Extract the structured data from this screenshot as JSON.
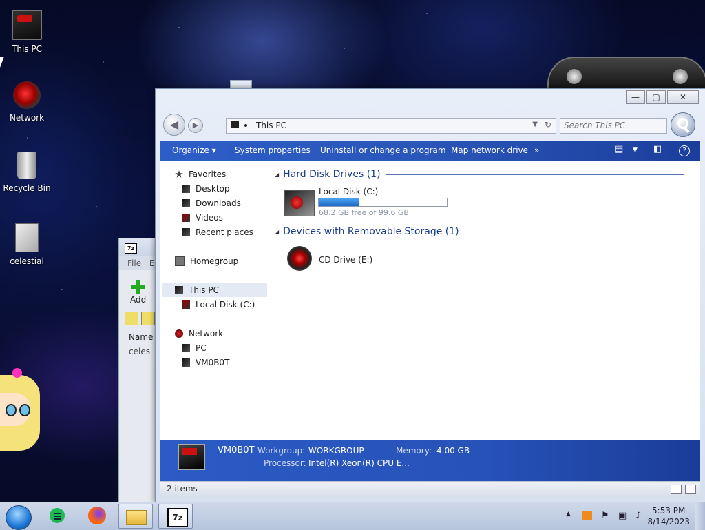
{
  "desktop": {
    "icons": [
      {
        "label": "This PC"
      },
      {
        "label": "Network"
      },
      {
        "label": "Recycle Bin"
      },
      {
        "label": "celestial"
      }
    ]
  },
  "zip_window": {
    "title_glyph": "7z",
    "menu": [
      "File",
      "E"
    ],
    "add_label": "Add",
    "column_name": "Name",
    "file_label": "celes"
  },
  "explorer": {
    "controls": {
      "minimize": "—",
      "maximize": "▢",
      "close": "✕"
    },
    "address": {
      "path": "This PC"
    },
    "search": {
      "placeholder": "Search This PC"
    },
    "commands": {
      "organize": "Organize ▾",
      "system_properties": "System properties",
      "uninstall": "Uninstall or change a program",
      "map_drive": "Map network drive",
      "more": "»"
    },
    "nav": {
      "favorites": "Favorites",
      "desktop": "Desktop",
      "downloads": "Downloads",
      "videos": "Videos",
      "recent": "Recent places",
      "homegroup": "Homegroup",
      "this_pc": "This PC",
      "local_disk": "Local Disk (C:)",
      "network": "Network",
      "pc": "PC",
      "vm": "VM0B0T"
    },
    "groups": {
      "hdd": "Hard Disk Drives (1)",
      "removable": "Devices with Removable Storage (1)"
    },
    "drives": {
      "c": {
        "name": "Local Disk (C:)",
        "free_text": "68.2 GB free of 99.6 GB",
        "used_fraction": 0.315
      },
      "e": {
        "name": "CD Drive (E:)"
      }
    },
    "details": {
      "computer_name": "VM0B0T",
      "workgroup_label": "Workgroup:",
      "workgroup": "WORKGROUP",
      "memory_label": "Memory:",
      "memory": "4.00 GB",
      "processor_label": "Processor:",
      "processor": "Intel(R) Xeon(R) CPU E..."
    },
    "status": {
      "items": "2 items"
    }
  },
  "taskbar": {
    "tray_arrow": "▲",
    "time": "5:53 PM",
    "date": "8/14/2023",
    "seven_z": "7z"
  }
}
